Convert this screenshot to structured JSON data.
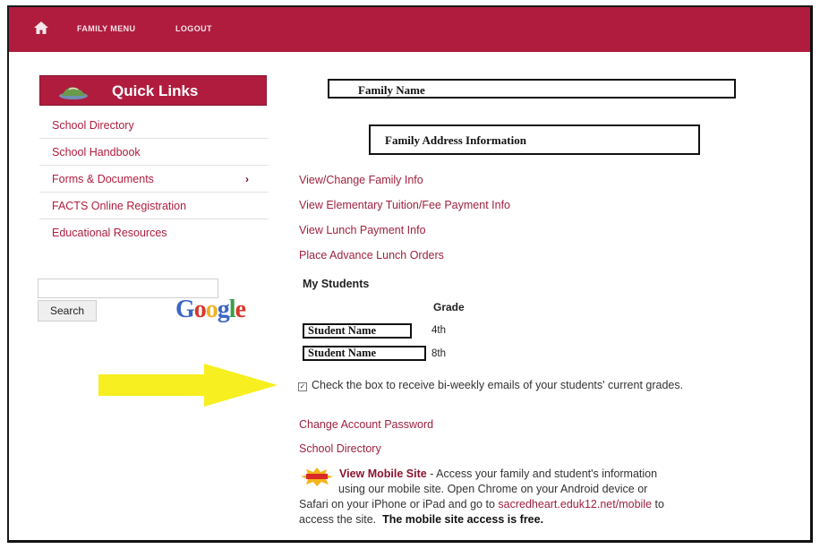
{
  "topbar": {
    "home_icon": "home-icon",
    "nav": [
      "FAMILY MENU",
      "LOGOUT"
    ],
    "color": "#b01c3e"
  },
  "quick_links": {
    "title": "Quick Links",
    "items": [
      "School Directory",
      "School Handbook",
      "Forms & Documents",
      "FACTS Online Registration",
      "Educational Resources"
    ],
    "submenu_indicator": "›"
  },
  "search": {
    "value": "",
    "button_label": "Search",
    "brand": "Google"
  },
  "family": {
    "name_box": "Family Name",
    "address_box": "Family Address Information"
  },
  "links": [
    "View/Change Family Info",
    "View Elementary Tuition/Fee Payment Info",
    "View Lunch Payment Info",
    "Place Advance Lunch Orders"
  ],
  "students": {
    "heading": "My Students",
    "grade_header": "Grade",
    "rows": [
      {
        "name": "Student Name",
        "grade": "4th"
      },
      {
        "name": "Student Name",
        "grade": "8th"
      }
    ]
  },
  "email_opt_in": {
    "checked": true,
    "label": "Check the box to receive bi-weekly emails of your students' current grades."
  },
  "account_links": [
    "Change Account Password",
    "School Directory"
  ],
  "mobile": {
    "link": "View Mobile Site",
    "text_1": " - Access your family and student's information",
    "text_2": "using our mobile site. Open Chrome on your Android device or",
    "text_3": "Safari on your iPhone or iPad and go to",
    "url": "sacredheart.eduk12.net/mobile",
    "text_4": " to",
    "text_5": "access the site.",
    "emphasis": "The mobile site access is free."
  },
  "annotation_arrow_color": "#f7ef1f"
}
